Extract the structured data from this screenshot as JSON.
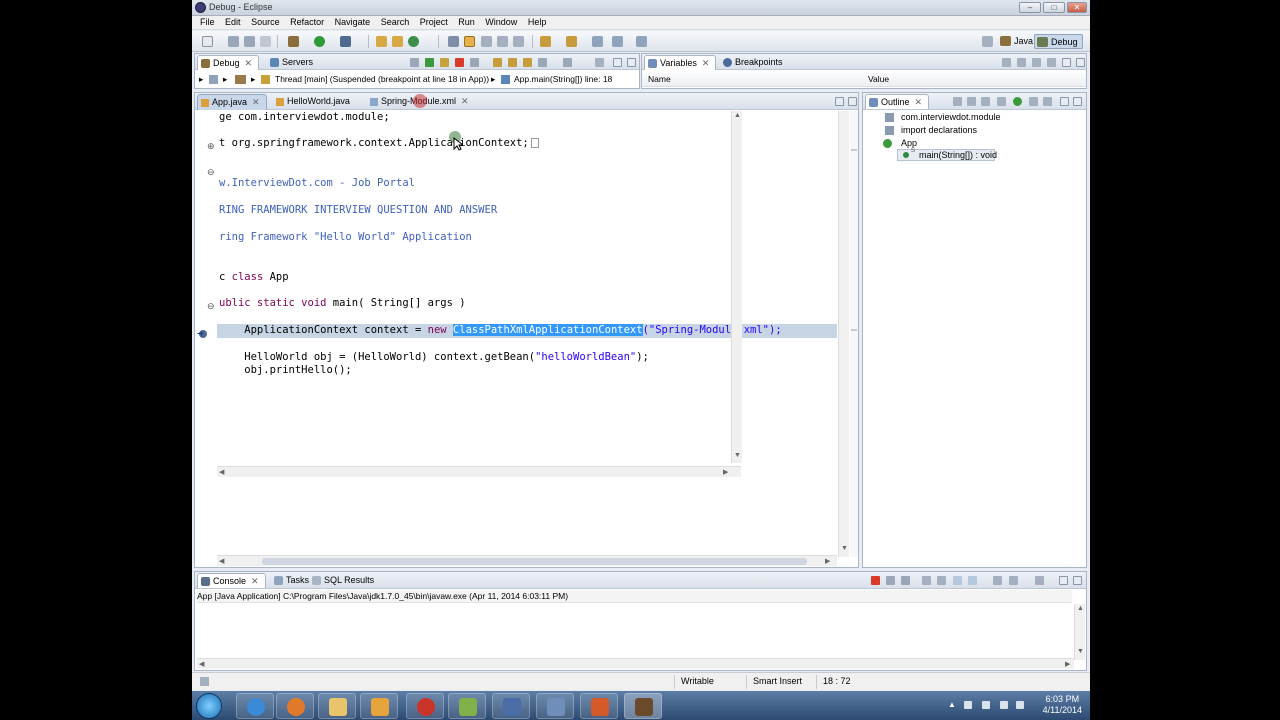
{
  "window": {
    "title": "Debug - Eclipse",
    "min": "–",
    "max": "□",
    "close": "✕"
  },
  "menu": [
    "File",
    "Edit",
    "Source",
    "Refactor",
    "Navigate",
    "Search",
    "Project",
    "Run",
    "Window",
    "Help"
  ],
  "perspectives": {
    "java": "Java",
    "debug": "Debug"
  },
  "debug_view": {
    "tabs": [
      {
        "label": "Debug",
        "close": "✕"
      },
      {
        "label": "Servers"
      }
    ],
    "thread": "Thread [main] (Suspended (breakpoint at line 18 in App))",
    "frame": "App.main(String[]) line: 18"
  },
  "variables_view": {
    "tabs": [
      {
        "label": "Variables",
        "close": "✕"
      },
      {
        "label": "Breakpoints"
      }
    ],
    "columns": [
      "Name",
      "Value"
    ]
  },
  "editor": {
    "tabs": [
      {
        "label": "App.java",
        "close": "✕"
      },
      {
        "label": "HelloWorld.java"
      },
      {
        "label": "Spring-Module.xml",
        "close": "✕"
      }
    ],
    "lines": {
      "l1": "ge com.interviewdot.module;",
      "l2": "t org.springframework.context.ApplicationContext;",
      "l3": "w.InterviewDot.com - Job Portal",
      "l4": "RING FRAMEWORK INTERVIEW QUESTION AND ANSWER",
      "l5": "ring Framework \"Hello World\" Application",
      "l6a": "c ",
      "l6b": "class",
      "l6c": " App",
      "l7a": "ublic static void",
      "l7b": " main( String[] args )",
      "l8a": "    ApplicationContext context = ",
      "l8b": "new",
      "l8c": " ",
      "l8d": "ClassPathXmlApplicationContext",
      "l8e": "(\"Spring-Module.xml\");",
      "l9a": "    HelloWorld obj = (HelloWorld) context.getBean(",
      "l9b": "\"helloWorldBean\"",
      "l9c": ");",
      "l10": "    obj.printHello();"
    },
    "fold_markers": [
      "⊕",
      "⊖",
      "⊖"
    ],
    "scroll_up": "▲",
    "scroll_down": "▼",
    "scroll_left": "◀",
    "scroll_right": "▶"
  },
  "outline": {
    "tab": "Outline",
    "close": "✕",
    "items": [
      "com.interviewdot.module",
      "import declarations",
      "App",
      "main(String[]) : void"
    ],
    "superscript": "S"
  },
  "console": {
    "tabs": [
      {
        "label": "Console",
        "close": "✕"
      },
      {
        "label": "Tasks"
      },
      {
        "label": "SQL Results"
      }
    ],
    "line": "App [Java Application] C:\\Program Files\\Java\\jdk1.7.0_45\\bin\\javaw.exe (Apr 11, 2014 6:03:11 PM)"
  },
  "status": {
    "writable": "Writable",
    "insert": "Smart Insert",
    "position": "18 : 72"
  },
  "clock": {
    "time": "6:03 PM",
    "date": "4/11/2014"
  },
  "colors": {
    "keyword": "#7f0055",
    "comment": "#3f5fbf",
    "string": "#2a00ff",
    "selection": "#3399ff",
    "current_line": "#c6d4e4"
  }
}
